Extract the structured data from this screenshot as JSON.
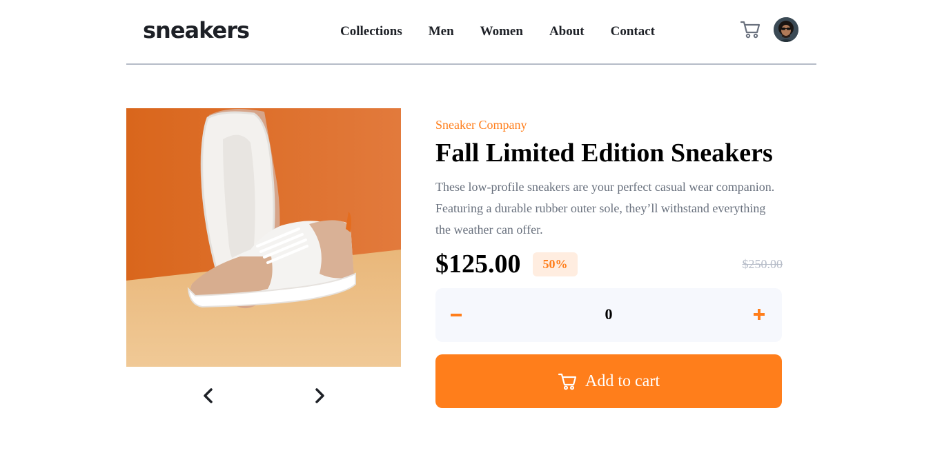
{
  "header": {
    "logo": "sneakers",
    "nav": [
      "Collections",
      "Men",
      "Women",
      "About",
      "Contact"
    ],
    "icons": {
      "cart": "cart-icon",
      "avatar": "user-avatar"
    }
  },
  "gallery": {
    "image_alt": "product-image-sneaker",
    "prev_icon": "chevron-left-icon",
    "next_icon": "chevron-right-icon"
  },
  "product": {
    "company": "Sneaker Company",
    "title": "Fall Limited Edition Sneakers",
    "description": "These low-profile sneakers are your perfect casual wear companion. Featuring a durable rubber outer sole, they’ll withstand everything the weather can offer.",
    "price": "$125.00",
    "discount": "50%",
    "original_price": "$250.00",
    "quantity": "0",
    "minus_icon": "minus-icon",
    "plus_icon": "plus-icon",
    "add_to_cart": "Add to cart"
  },
  "colors": {
    "accent": "#ff7e1b",
    "accent_pale": "#ffede0",
    "text_dark": "#1d2026",
    "text_muted": "#68707d",
    "line": "#b6bcc8",
    "panel": "#f6f8fd"
  }
}
